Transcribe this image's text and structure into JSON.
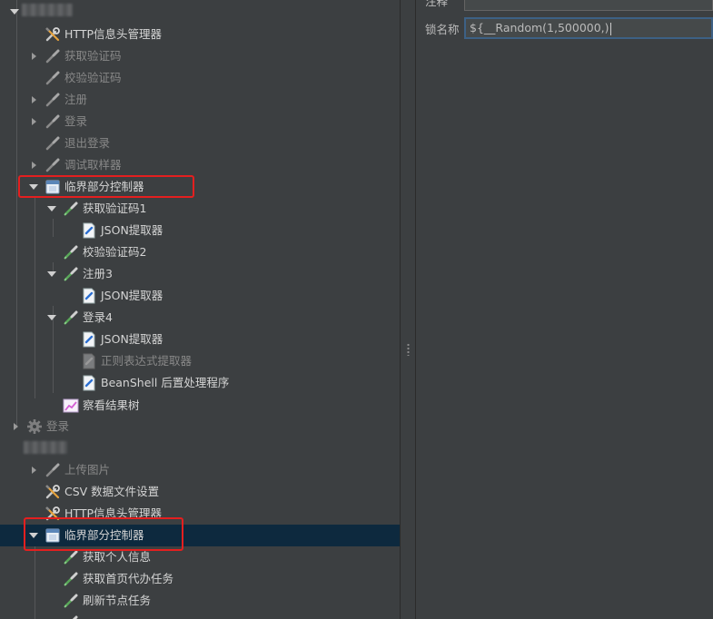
{
  "tree": {
    "blurred_top": "",
    "items": [
      {
        "label": "HTTP信息头管理器",
        "icon": "wrench-icon",
        "enabled": true
      },
      {
        "label": "获取验证码",
        "icon": "pipette-icon",
        "enabled": false
      },
      {
        "label": "校验验证码",
        "icon": "pipette-icon",
        "enabled": false
      },
      {
        "label": "注册",
        "icon": "pipette-icon",
        "enabled": false
      },
      {
        "label": "登录",
        "icon": "pipette-icon",
        "enabled": false
      },
      {
        "label": "退出登录",
        "icon": "pipette-icon",
        "enabled": false
      },
      {
        "label": "调试取样器",
        "icon": "pipette-icon",
        "enabled": false
      },
      {
        "label": "临界部分控制器",
        "icon": "controller-icon",
        "enabled": true
      },
      {
        "label": "获取验证码1",
        "icon": "pipette-icon",
        "enabled": true
      },
      {
        "label": "JSON提取器",
        "icon": "extractor-icon",
        "enabled": true
      },
      {
        "label": "校验验证码2",
        "icon": "pipette-icon",
        "enabled": true
      },
      {
        "label": "注册3",
        "icon": "pipette-icon",
        "enabled": true
      },
      {
        "label": "JSON提取器",
        "icon": "extractor-icon",
        "enabled": true
      },
      {
        "label": "登录4",
        "icon": "pipette-icon",
        "enabled": true
      },
      {
        "label": "JSON提取器",
        "icon": "extractor-icon",
        "enabled": true
      },
      {
        "label": "正则表达式提取器",
        "icon": "extractor-icon",
        "enabled": false
      },
      {
        "label": "BeanShell 后置处理程序",
        "icon": "extractor-icon",
        "enabled": true
      },
      {
        "label": "察看结果树",
        "icon": "chart-icon",
        "enabled": true
      },
      {
        "label": "登录",
        "icon": "gear-icon",
        "enabled": false
      },
      {
        "label": "",
        "icon": "none",
        "enabled": false
      },
      {
        "label": "上传图片",
        "icon": "pipette-icon",
        "enabled": false
      },
      {
        "label": "CSV 数据文件设置",
        "icon": "wrench-icon",
        "enabled": true
      },
      {
        "label": "HTTP信息头管理器",
        "icon": "wrench-icon",
        "enabled": true
      },
      {
        "label": "临界部分控制器",
        "icon": "controller-icon",
        "enabled": true
      },
      {
        "label": "获取个人信息",
        "icon": "pipette-icon",
        "enabled": true
      },
      {
        "label": "获取首页代办任务",
        "icon": "pipette-icon",
        "enabled": true
      },
      {
        "label": "刷新节点任务",
        "icon": "pipette-icon",
        "enabled": true
      },
      {
        "label": "",
        "icon": "pipette-icon",
        "enabled": true
      }
    ]
  },
  "panel": {
    "top_label": "注释",
    "lock_name_label": "锁名称",
    "lock_name_value": "${__Random(1,500000,)"
  },
  "colors": {
    "highlight": "#e41f1f",
    "selection": "#0d293e",
    "background": "#3c3f41"
  }
}
